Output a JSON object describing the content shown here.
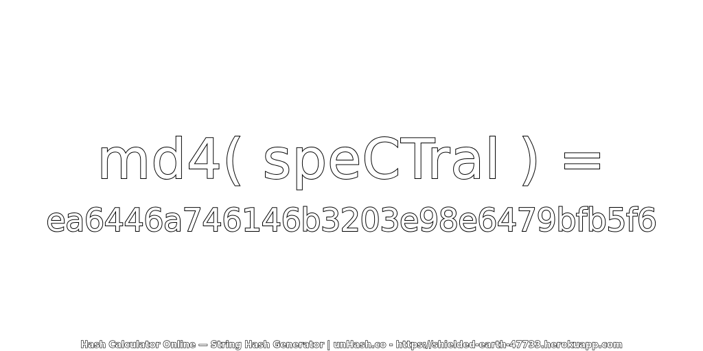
{
  "expression": "md4( speCTral ) =",
  "hash_value": "ea6446a746146b3203e98e6479bfb5f6",
  "footer": "Hash Calculator Online — String Hash Generator | unHash.co - https://shielded-earth-47733.herokuapp.com"
}
